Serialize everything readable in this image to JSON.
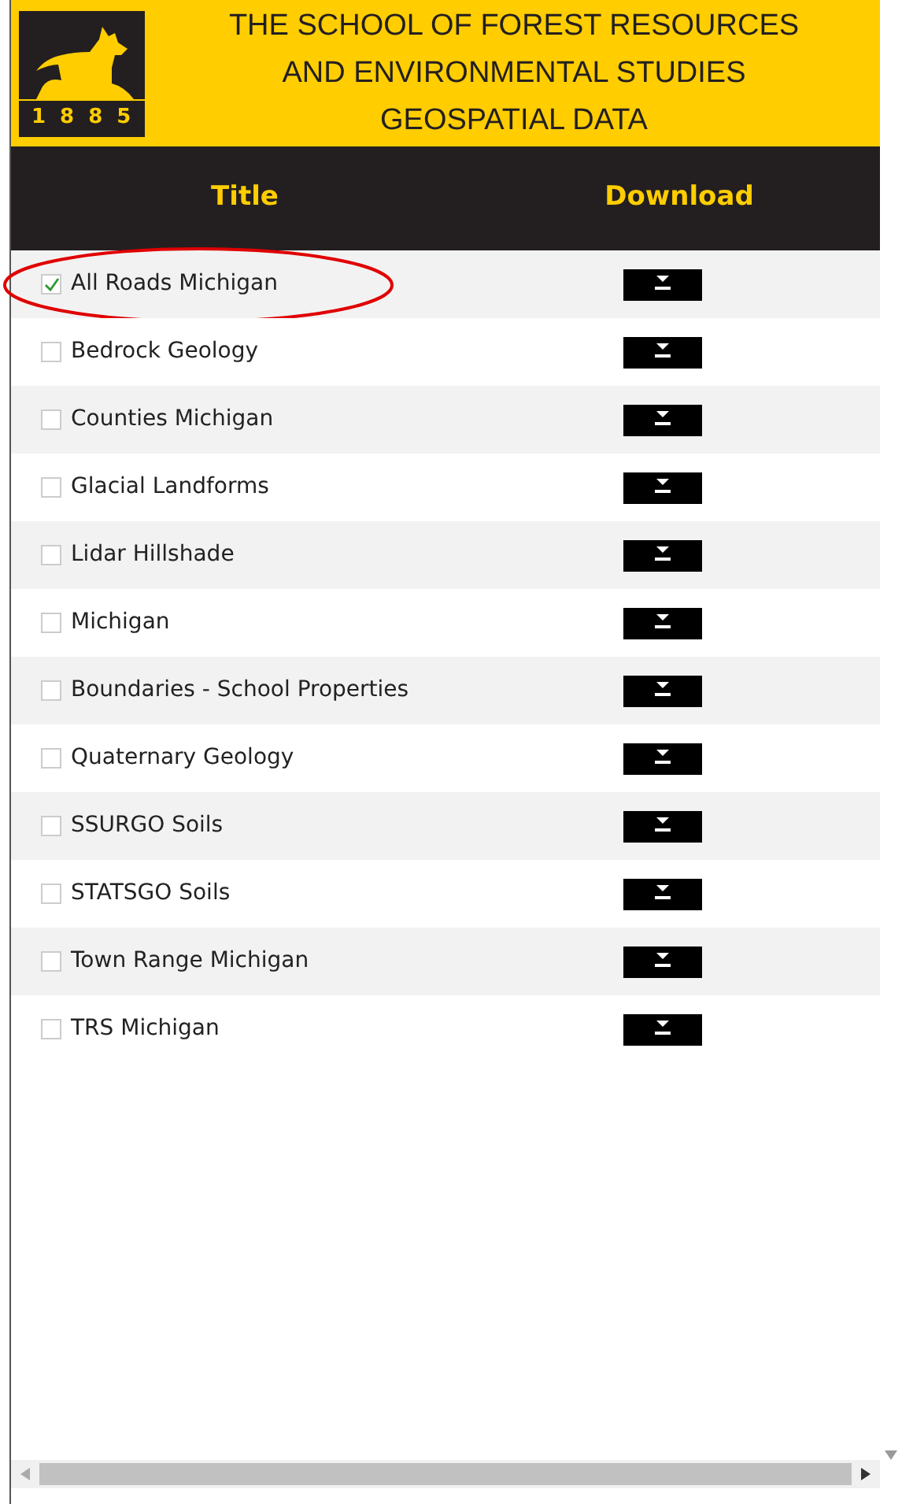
{
  "header": {
    "logo_year": "1885",
    "title_lines": [
      "THE SCHOOL OF FOREST RESOURCES",
      "AND ENVIRONMENTAL STUDIES",
      "GEOSPATIAL DATA"
    ]
  },
  "table": {
    "columns": [
      "Title",
      "Download"
    ],
    "rows": [
      {
        "title": "All Roads Michigan",
        "checked": true,
        "highlighted": true
      },
      {
        "title": "Bedrock Geology",
        "checked": false,
        "highlighted": false
      },
      {
        "title": "Counties Michigan",
        "checked": false,
        "highlighted": false
      },
      {
        "title": "Glacial Landforms",
        "checked": false,
        "highlighted": false
      },
      {
        "title": "Lidar Hillshade",
        "checked": false,
        "highlighted": false
      },
      {
        "title": "Michigan",
        "checked": false,
        "highlighted": false
      },
      {
        "title": "Boundaries - School Properties",
        "checked": false,
        "highlighted": false
      },
      {
        "title": "Quaternary Geology",
        "checked": false,
        "highlighted": false
      },
      {
        "title": "SSURGO Soils",
        "checked": false,
        "highlighted": false
      },
      {
        "title": "STATSGO Soils",
        "checked": false,
        "highlighted": false
      },
      {
        "title": "Town Range Michigan",
        "checked": false,
        "highlighted": false
      },
      {
        "title": "TRS Michigan",
        "checked": false,
        "highlighted": false
      }
    ]
  }
}
